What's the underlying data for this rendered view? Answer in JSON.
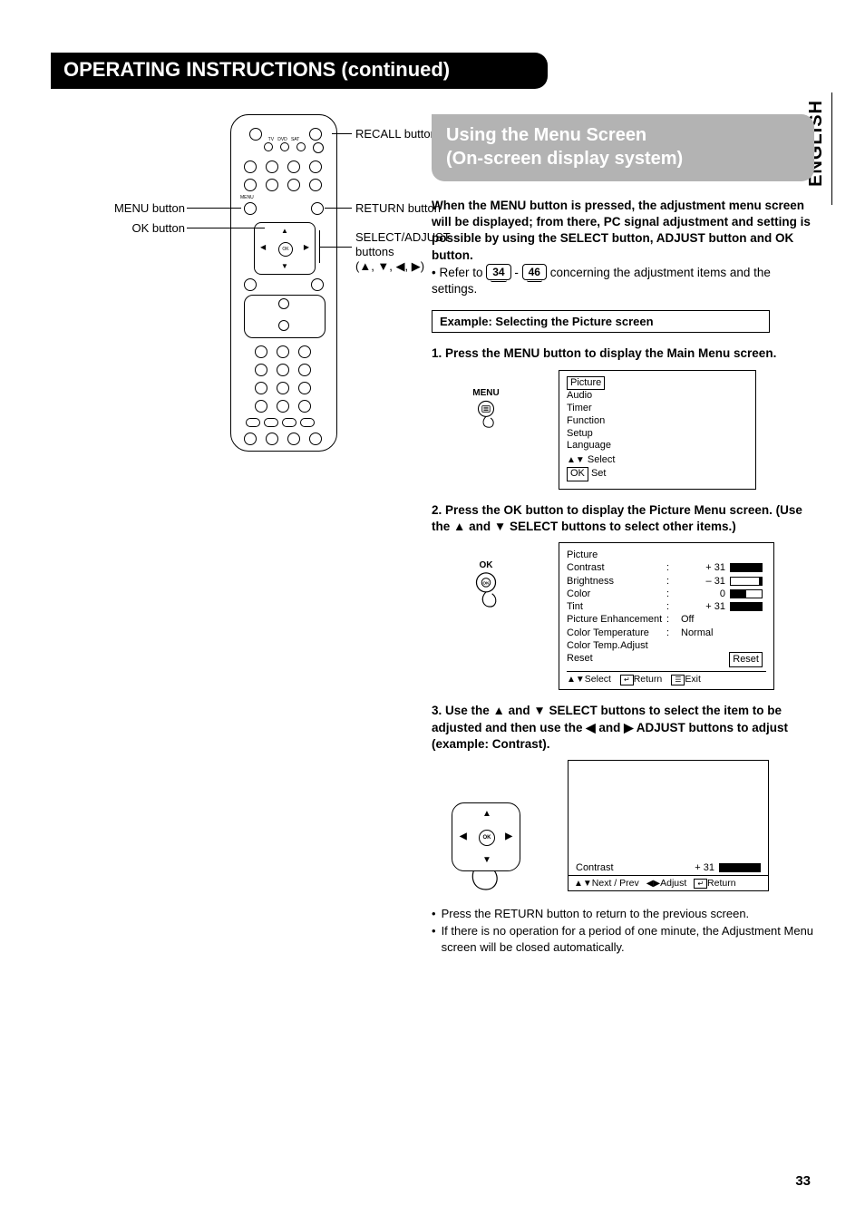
{
  "header": {
    "title": "OPERATING INSTRUCTIONS (continued)"
  },
  "language_tab": "ENGLISH",
  "page_number": "33",
  "remote_callouts": {
    "menu_button": "MENU button",
    "ok_button": "OK button",
    "recall_button": "RECALL button",
    "return_button": "RETURN button",
    "select_adjust_top": "SELECT/ADJUST",
    "select_adjust_bot": "buttons",
    "select_adjust_arrows": "(▲, ▼, ◀, ▶)"
  },
  "section": {
    "line1": "Using the Menu Screen",
    "line2": "(On-screen display system)"
  },
  "intro": {
    "bold": "When the MENU button is pressed, the adjustment menu screen will be displayed; from there, PC signal adjustment and setting is possible by using the SELECT button, ADJUST button and OK button.",
    "refer_prefix": "• Refer to ",
    "ref1": "34",
    "ref_dash": " - ",
    "ref2": "46",
    "refer_suffix": " concerning the adjustment items and the settings."
  },
  "example_title": "Example: Selecting the Picture screen",
  "steps": {
    "s1": "1. Press the MENU button to display the Main Menu screen.",
    "s1_icon_label": "MENU",
    "s1_menu_items": [
      "Picture",
      "Audio",
      "Timer",
      "Function",
      "Setup",
      "Language"
    ],
    "s1_footer_select": "Select",
    "s1_footer_set_btn": "OK",
    "s1_footer_set_label": "Set",
    "s2": "2. Press the OK button to display the Picture Menu screen. (Use the ▲ and ▼ SELECT buttons to select other items.)",
    "s2_icon_label": "OK",
    "s2_title": "Picture",
    "s2_rows": [
      {
        "k": "Contrast",
        "v": "+ 31",
        "bar": "fill"
      },
      {
        "k": "Brightness",
        "v": "– 31",
        "bar": "empty"
      },
      {
        "k": "Color",
        "v": "0",
        "bar": "half"
      },
      {
        "k": "Tint",
        "v": "+ 31",
        "bar": "fill"
      },
      {
        "k": "Picture Enhancement",
        "v": "Off",
        "bar": ""
      },
      {
        "k": "Color Temperature",
        "v": "Normal",
        "bar": ""
      },
      {
        "k": "Color Temp.Adjust",
        "v": "",
        "bar": ""
      },
      {
        "k": "Reset",
        "v": "",
        "boxed": "Reset"
      }
    ],
    "s2_footer_select": "Select",
    "s2_footer_return": "Return",
    "s2_footer_exit": "Exit",
    "s3": "3. Use the ▲ and ▼ SELECT buttons to select the item to be adjusted and then use the ◀ and ▶ ADJUST buttons to adjust (example: Contrast).",
    "s3_contrast_label": "Contrast",
    "s3_contrast_value": "+ 31",
    "s3_footer_next": "Next / Prev",
    "s3_footer_adjust": "Adjust",
    "s3_footer_return": "Return"
  },
  "notes": {
    "n1": "Press the RETURN button to return to the previous screen.",
    "n2": "If there is no operation for a period of one minute, the Adjustment Menu screen will be closed automatically."
  }
}
